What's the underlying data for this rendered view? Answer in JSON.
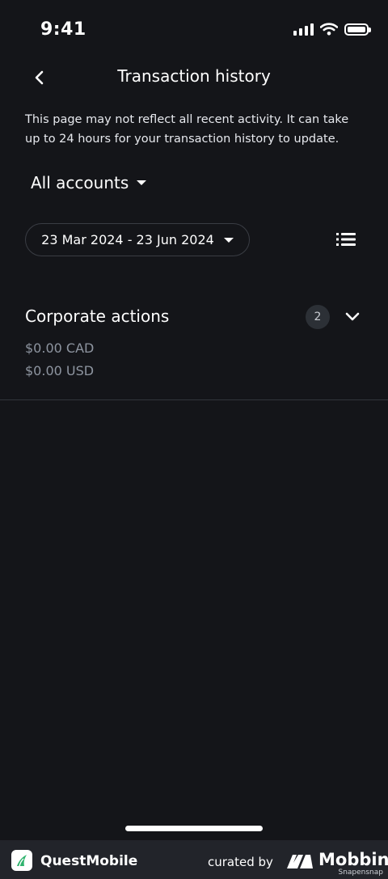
{
  "status_bar": {
    "time": "9:41",
    "icons": [
      "signal-icon",
      "wifi-icon",
      "battery-icon"
    ]
  },
  "header": {
    "title": "Transaction history",
    "back_icon": "chevron-left-icon"
  },
  "notice": "This page may not reflect all recent activity. It can take up to 24 hours for your transaction history to update.",
  "filters": {
    "account": "All accounts",
    "date_range": "23 Mar 2024 - 23 Jun 2024",
    "list_icon": "list-icon"
  },
  "section": {
    "title": "Corporate actions",
    "count": "2",
    "amounts": [
      "$0.00 CAD",
      "$0.00 USD"
    ]
  },
  "footer": {
    "brand": "QuestMobile",
    "curated": "curated by",
    "mobbin": "Mobbin",
    "watermark": "Snapensnap"
  },
  "colors": {
    "background": "#141519",
    "text": "#ffffff",
    "muted": "#8e95a0",
    "badge": "#2c3036",
    "brand_green": "#2fb36e"
  }
}
